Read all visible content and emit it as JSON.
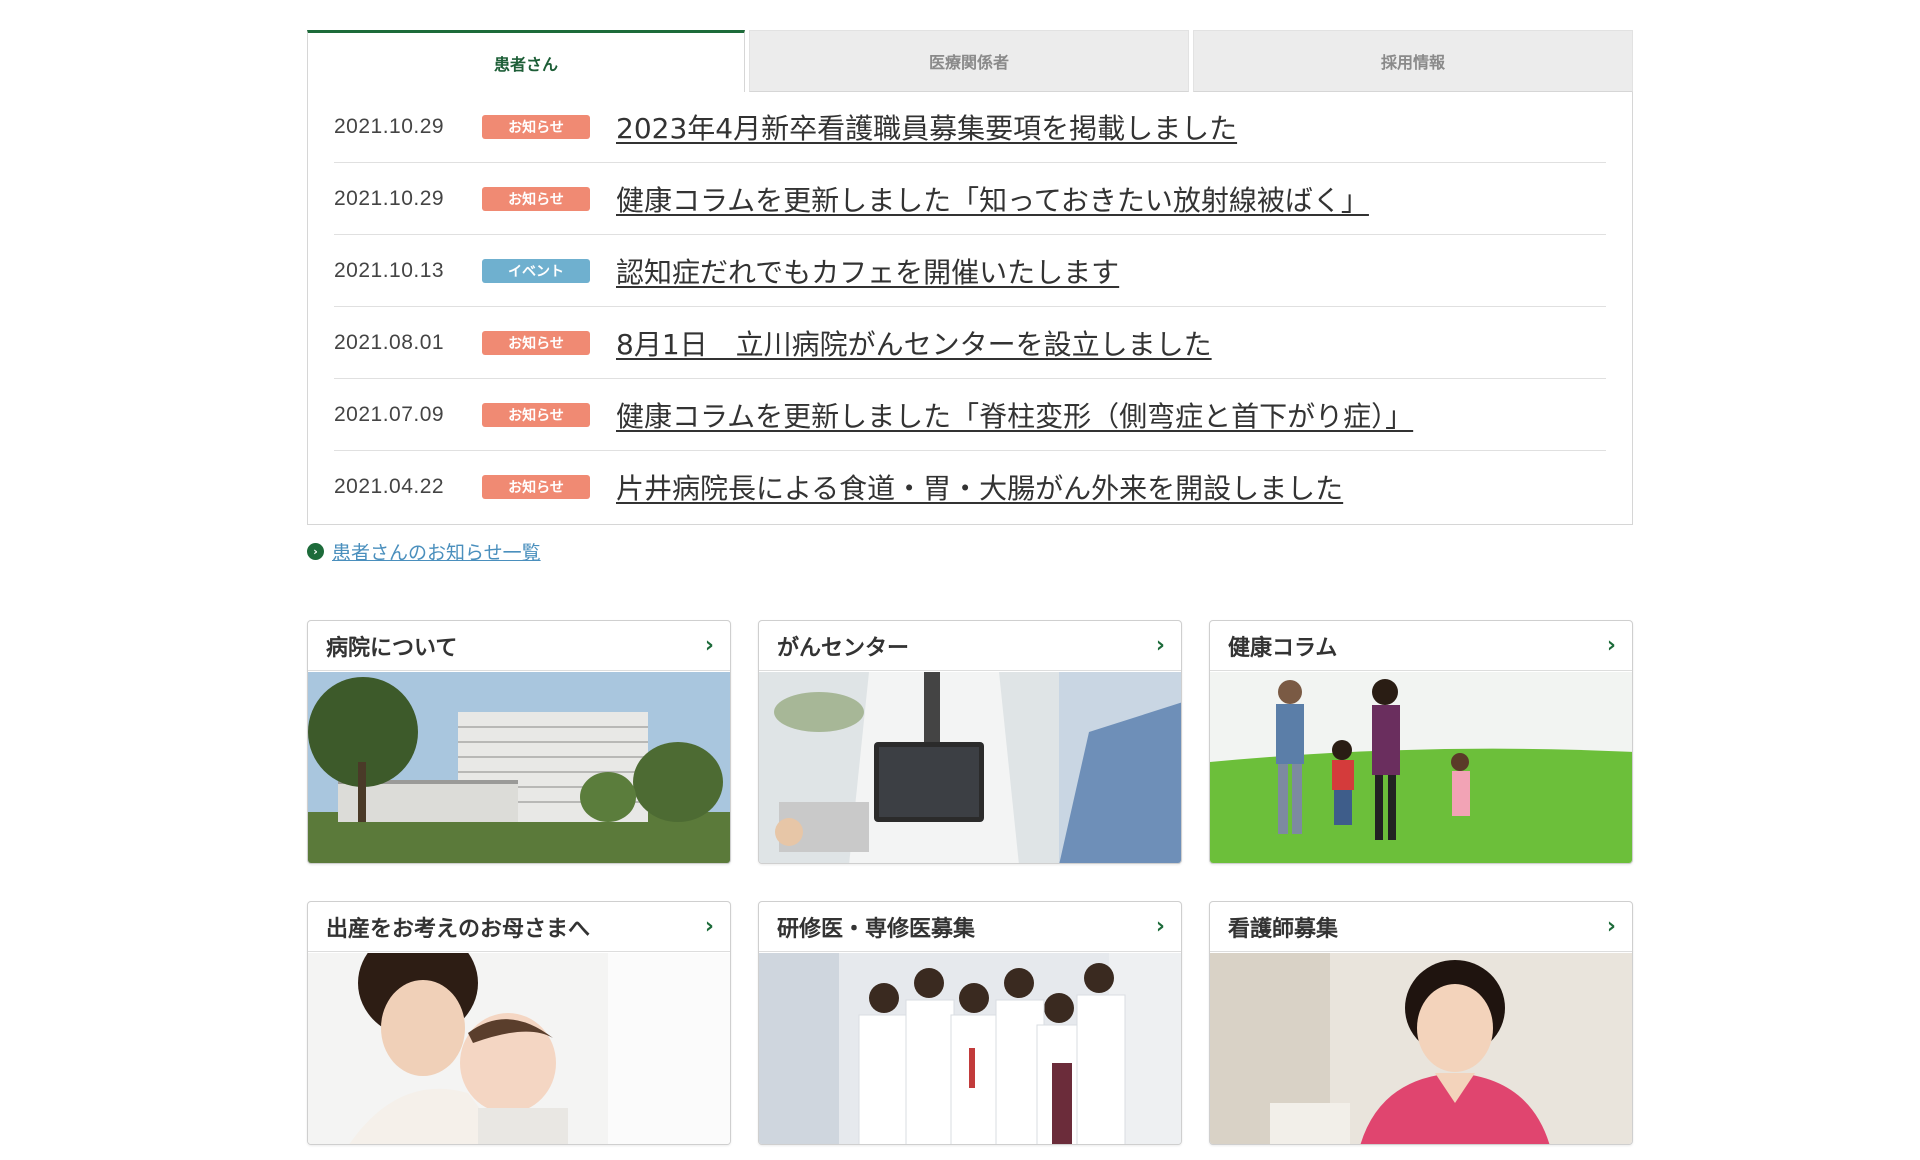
{
  "tabs": [
    {
      "label": "患者さん",
      "active": true
    },
    {
      "label": "医療関係者",
      "active": false
    },
    {
      "label": "採用情報",
      "active": false
    }
  ],
  "news": [
    {
      "date": "2021.10.29",
      "badge": "お知らせ",
      "title": "2023年4月新卒看護職員募集要項を掲載しました"
    },
    {
      "date": "2021.10.29",
      "badge": "お知らせ",
      "title": "健康コラムを更新しました「知っておきたい放射線被ばく」"
    },
    {
      "date": "2021.10.13",
      "badge": "イベント",
      "title": "認知症だれでもカフェを開催いたします"
    },
    {
      "date": "2021.08.01",
      "badge": "お知らせ",
      "title": "8月1日　立川病院がんセンターを設立しました"
    },
    {
      "date": "2021.07.09",
      "badge": "お知らせ",
      "title": "健康コラムを更新しました「脊柱変形（側弯症と首下がり症）」"
    },
    {
      "date": "2021.04.22",
      "badge": "お知らせ",
      "title": "片井病院長による食道・胃・大腸がん外来を開設しました"
    }
  ],
  "more_link": "患者さんのお知らせ一覧",
  "cards": [
    {
      "title": "病院について",
      "icon": "chevron-right-icon"
    },
    {
      "title": "がんセンター",
      "icon": "chevron-right-icon"
    },
    {
      "title": "健康コラム",
      "icon": "chevron-right-icon"
    },
    {
      "title": "出産をお考えのお母さまへ",
      "icon": "chevron-right-icon"
    },
    {
      "title": "研修医・専修医募集",
      "icon": "chevron-right-icon"
    },
    {
      "title": "看護師募集",
      "icon": "chevron-right-icon"
    }
  ],
  "colors": {
    "brand_green": "#1d6b3a",
    "badge_notice": "#f08a73",
    "badge_event": "#6fb0cf",
    "link_blue": "#4a8fbd"
  }
}
